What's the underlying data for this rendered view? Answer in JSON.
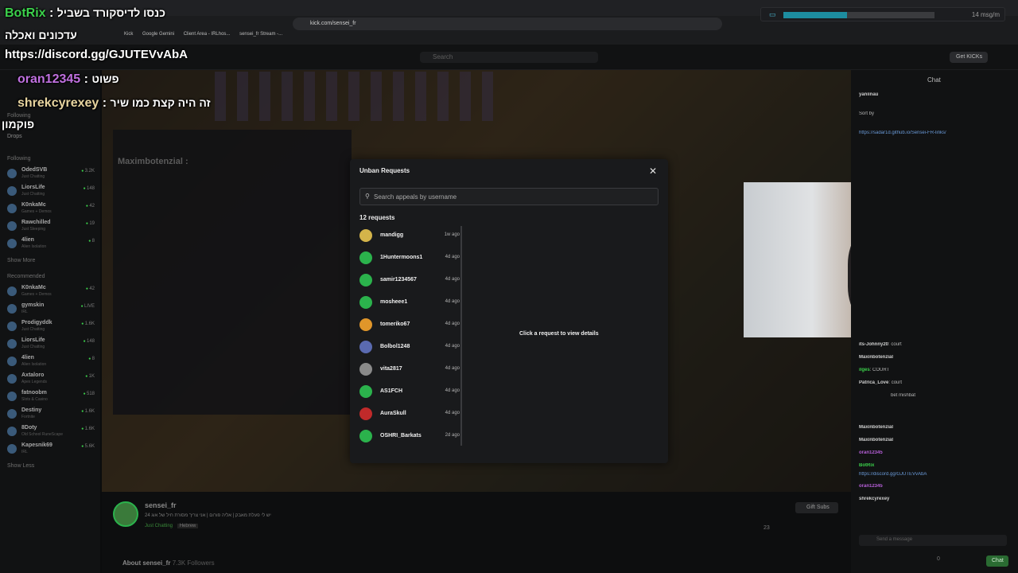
{
  "browser": {
    "tab_title": "sensei_fr Stream - Watch Live o...",
    "url": "kick.com/sensei_fr",
    "bookmarks": [
      "Kick",
      "Google Gemini",
      "Client Area - IRLhos...",
      "sensei_fr Stream -..."
    ]
  },
  "kick_header": {
    "search_placeholder": "Search",
    "get_kicks": "Get KICKs"
  },
  "sidebar": {
    "drops": "Drops",
    "following_label": "Following",
    "following_heading": "Following",
    "following": [
      {
        "name": "OdedSVB",
        "category": "Just Chatting",
        "viewers": "3.2K"
      },
      {
        "name": "LiorsLife",
        "category": "Just Chatting",
        "viewers": "148"
      },
      {
        "name": "K0nkaMc",
        "category": "Games + Demos",
        "viewers": "42"
      },
      {
        "name": "Rawchilled",
        "category": "Just Sleeping",
        "viewers": "19"
      },
      {
        "name": "4lien",
        "category": "Alien Isolation",
        "viewers": "8"
      }
    ],
    "show_more": "Show More",
    "recommended_heading": "Recommended",
    "recommended": [
      {
        "name": "K0nkaMc",
        "category": "Games + Demos",
        "viewers": "42"
      },
      {
        "name": "gymskin",
        "category": "IRL",
        "viewers": "LIVE"
      },
      {
        "name": "Prodigyddk",
        "category": "Just Chatting",
        "viewers": "1.6K"
      },
      {
        "name": "LiorsLife",
        "category": "Just Chatting",
        "viewers": "148"
      },
      {
        "name": "4lien",
        "category": "Alien Isolation",
        "viewers": "8"
      },
      {
        "name": "Axtaloro",
        "category": "Apex Legends",
        "viewers": "1K"
      },
      {
        "name": "fatnoobm",
        "category": "Slots & Casino",
        "viewers": "518"
      },
      {
        "name": "Destiny",
        "category": "Fortnite",
        "viewers": "1.6K"
      },
      {
        "name": "8Doty",
        "category": "Old School RuneScape",
        "viewers": "1.6K"
      },
      {
        "name": "Kapesnik69",
        "category": "IRL",
        "viewers": "5.6K"
      }
    ],
    "show_less": "Show Less"
  },
  "modal": {
    "title": "Unban Requests",
    "search_placeholder": "Search appeals by username",
    "count_label": "12 requests",
    "empty_detail": "Click a request to view details",
    "requests": [
      {
        "name": "mandigg",
        "time": "1w ago",
        "color": "#d4b44a"
      },
      {
        "name": "1Huntermoons1",
        "time": "4d ago",
        "color": "#2bb24c"
      },
      {
        "name": "samir1234567",
        "time": "4d ago",
        "color": "#2bb24c"
      },
      {
        "name": "mosheee1",
        "time": "4d ago",
        "color": "#2bb24c"
      },
      {
        "name": "tomeriko67",
        "time": "4d ago",
        "color": "#e0962a"
      },
      {
        "name": "Bolbol1248",
        "time": "4d ago",
        "color": "#5a6ab0"
      },
      {
        "name": "vita2817",
        "time": "4d ago",
        "color": "#8a8a8a"
      },
      {
        "name": "AS1FCH",
        "time": "4d ago",
        "color": "#2bb24c"
      },
      {
        "name": "AuraSkull",
        "time": "4d ago",
        "color": "#c02a2a"
      },
      {
        "name": "OSHRI_Barkats",
        "time": "2d ago",
        "color": "#2bb24c"
      }
    ]
  },
  "chat": {
    "title": "Chat",
    "lines": [
      {
        "user": "yaniinau",
        "text": ""
      },
      {
        "user": "Sort by",
        "text": ""
      },
      {
        "user": "",
        "text": "https://sadar1d.github.io/Sensei-FR-links/"
      },
      {
        "user": "its-Johnny20",
        "text": "court"
      },
      {
        "user": "Maxinbotenzial",
        "text": ""
      },
      {
        "user": "ilges",
        "text": "COURT"
      },
      {
        "user": "Patrica_Love",
        "text": "court"
      },
      {
        "user": "",
        "text": "bet mishbat"
      },
      {
        "user": "Maxinbotenzial",
        "text": ""
      },
      {
        "user": "Maxinbotenzial",
        "text": ""
      },
      {
        "user": "oran12345",
        "text": ""
      },
      {
        "user": "BotRix",
        "text": ""
      },
      {
        "user": "",
        "text": "https://discord.gg/GJUTEVvAbA"
      },
      {
        "user": "oran12345",
        "text": ""
      },
      {
        "user": "shrekcyrexey",
        "text": ""
      }
    ],
    "input_placeholder": "Send a message",
    "send_label": "Chat",
    "points": "0"
  },
  "stream": {
    "streamer": "sensei_fr",
    "title": "24 יש לי פעלת מאבק | אליה פורום | אני צריך מסורת חיל של אוג",
    "category": "Just Chatting",
    "language": "Hebrew",
    "gift_subs": "Gift Subs",
    "viewers": "23",
    "about": "About sensei_fr",
    "followers": "7.3K Followers"
  },
  "overlay": {
    "msg_rate": "14 msg/m",
    "msg_rate_level": 0.42,
    "lines": [
      {
        "user": "BotRix",
        "text": "כנסו לדיסקורד בשביל",
        "color": "#3bd14b"
      },
      {
        "user": "",
        "text": "עדכונים ואכלה",
        "color": "#ffffff"
      },
      {
        "user": "",
        "text": "https://discord.gg/GJUTEVvAbA",
        "color": "#ffffff"
      },
      {
        "user": "oran12345",
        "text": "פשוט",
        "color": "#c070e0"
      },
      {
        "user": "shrekcyrexey",
        "text": "זה היה קצת כמו שיר",
        "color": "#e8d5a0"
      },
      {
        "user": "",
        "text": "פוקמון",
        "color": "#ffffff"
      }
    ],
    "background_echo": "Maximbotenzial :"
  }
}
